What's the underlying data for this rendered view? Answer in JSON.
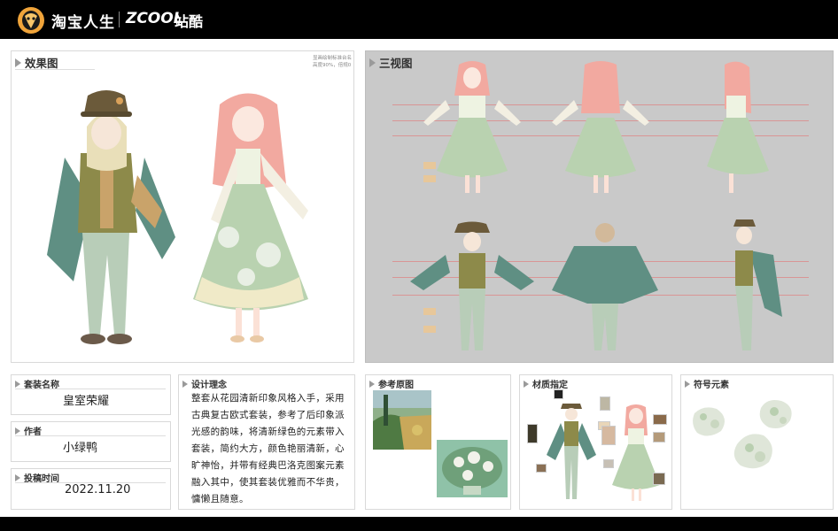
{
  "header": {
    "brand_taobao": "淘宝人生",
    "brand_zcool": "ZCOOL",
    "brand_zcool_cn": "站酷",
    "logo_icon": "taobao-life-logo-icon"
  },
  "panels": {
    "effect": {
      "title": "效果图",
      "note_line1": "显画绘制标准台名",
      "note_line2": "高度90%，倍规0"
    },
    "three_view": {
      "title": "三视图"
    },
    "outfit_name": {
      "label": "套装名称",
      "value": "皇室荣耀"
    },
    "author": {
      "label": "作者",
      "value": "小绿鸭"
    },
    "submit_time": {
      "label": "投稿时间",
      "value": "2022.11.20"
    },
    "design_concept": {
      "label": "设计理念",
      "text": "整套从花园清新印象风格入手，采用古典复古欧式套装，参考了后印象派光感的韵味，将清新绿色的元素带入套装，简约大方，颜色艳丽清新，心旷神怡，并带有经典巴洛克图案元素融入其中，使其套装优雅而不华贵，慵懒且随意。"
    },
    "reference": {
      "label": "参考原图"
    },
    "material": {
      "label": "材质指定"
    },
    "symbols": {
      "label": "符号元素"
    }
  },
  "colors": {
    "topbar": "#000000",
    "panel_gray": "#c9c9c9",
    "cape_green": "#5f8f83",
    "dress_green": "#b9d2b0",
    "hair_pink": "#f2a9a0",
    "hair_blond": "#e9dfb9",
    "hat_brown": "#6b5a3a",
    "pants": "#b8cdb8"
  }
}
